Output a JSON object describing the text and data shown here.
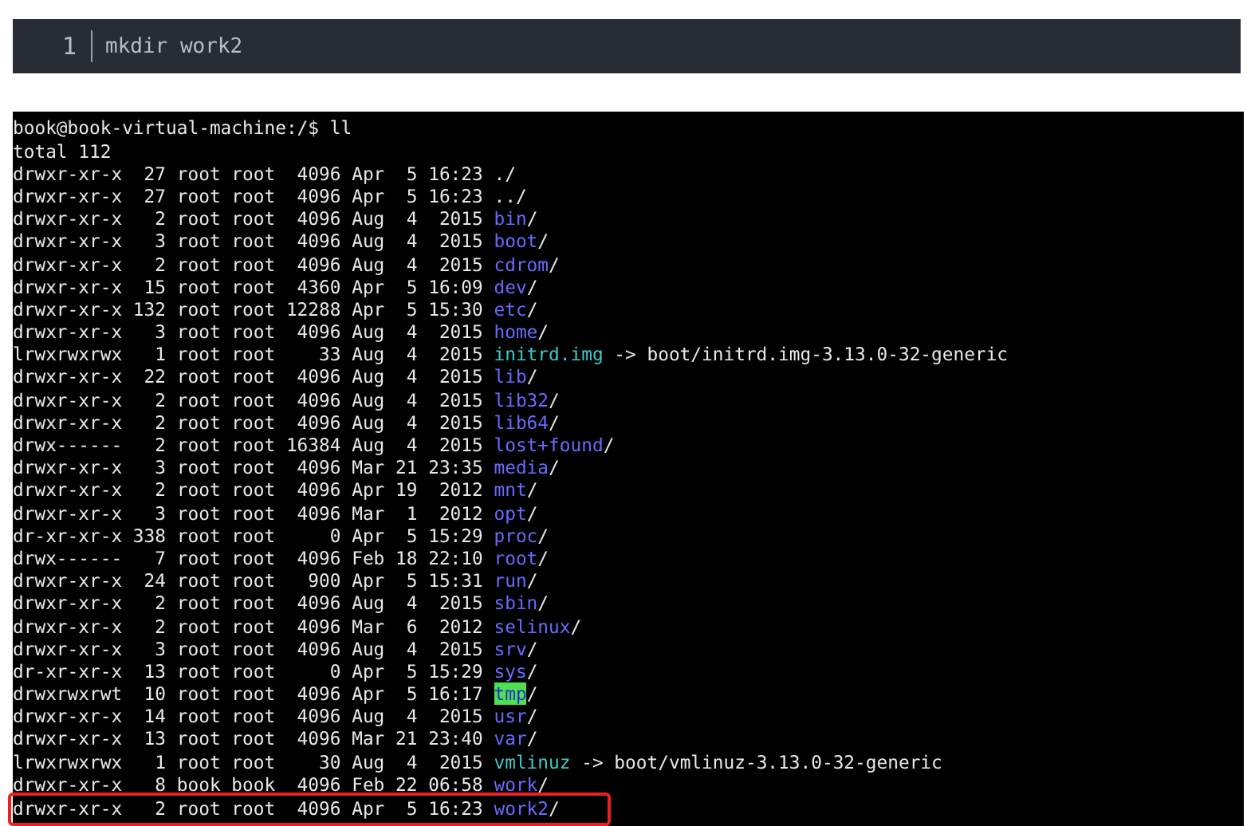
{
  "code_block": {
    "line_number": "1",
    "code": "mkdir work2"
  },
  "terminal": {
    "prompt": "book@book-virtual-machine:/$ ll",
    "total": "total 112",
    "entries": [
      {
        "info": "drwxr-xr-x  27 root root  4096 Apr  5 16:23",
        "name": ".",
        "suffix": "/",
        "kind": "plain",
        "highlighted": false
      },
      {
        "info": "drwxr-xr-x  27 root root  4096 Apr  5 16:23",
        "name": "..",
        "suffix": "/",
        "kind": "plain",
        "highlighted": false
      },
      {
        "info": "drwxr-xr-x   2 root root  4096 Aug  4  2015",
        "name": "bin",
        "suffix": "/",
        "kind": "dir",
        "highlighted": false
      },
      {
        "info": "drwxr-xr-x   3 root root  4096 Aug  4  2015",
        "name": "boot",
        "suffix": "/",
        "kind": "dir",
        "highlighted": false
      },
      {
        "info": "drwxr-xr-x   2 root root  4096 Aug  4  2015",
        "name": "cdrom",
        "suffix": "/",
        "kind": "dir",
        "highlighted": false
      },
      {
        "info": "drwxr-xr-x  15 root root  4360 Apr  5 16:09",
        "name": "dev",
        "suffix": "/",
        "kind": "dir",
        "highlighted": false
      },
      {
        "info": "drwxr-xr-x 132 root root 12288 Apr  5 15:30",
        "name": "etc",
        "suffix": "/",
        "kind": "dir",
        "highlighted": false
      },
      {
        "info": "drwxr-xr-x   3 root root  4096 Aug  4  2015",
        "name": "home",
        "suffix": "/",
        "kind": "dir",
        "highlighted": false
      },
      {
        "info": "lrwxrwxrwx   1 root root    33 Aug  4  2015",
        "name": "initrd.img",
        "suffix": "-> boot/initrd.img-3.13.0-32-generic",
        "kind": "link",
        "highlighted": false
      },
      {
        "info": "drwxr-xr-x  22 root root  4096 Aug  4  2015",
        "name": "lib",
        "suffix": "/",
        "kind": "dir",
        "highlighted": false
      },
      {
        "info": "drwxr-xr-x   2 root root  4096 Aug  4  2015",
        "name": "lib32",
        "suffix": "/",
        "kind": "dir",
        "highlighted": false
      },
      {
        "info": "drwxr-xr-x   2 root root  4096 Aug  4  2015",
        "name": "lib64",
        "suffix": "/",
        "kind": "dir",
        "highlighted": false
      },
      {
        "info": "drwx------   2 root root 16384 Aug  4  2015",
        "name": "lost+found",
        "suffix": "/",
        "kind": "dir",
        "highlighted": false
      },
      {
        "info": "drwxr-xr-x   3 root root  4096 Mar 21 23:35",
        "name": "media",
        "suffix": "/",
        "kind": "dir",
        "highlighted": false
      },
      {
        "info": "drwxr-xr-x   2 root root  4096 Apr 19  2012",
        "name": "mnt",
        "suffix": "/",
        "kind": "dir",
        "highlighted": false
      },
      {
        "info": "drwxr-xr-x   3 root root  4096 Mar  1  2012",
        "name": "opt",
        "suffix": "/",
        "kind": "dir",
        "highlighted": false
      },
      {
        "info": "dr-xr-xr-x 338 root root     0 Apr  5 15:29",
        "name": "proc",
        "suffix": "/",
        "kind": "dir",
        "highlighted": false
      },
      {
        "info": "drwx------   7 root root  4096 Feb 18 22:10",
        "name": "root",
        "suffix": "/",
        "kind": "dir",
        "highlighted": false
      },
      {
        "info": "drwxr-xr-x  24 root root   900 Apr  5 15:31",
        "name": "run",
        "suffix": "/",
        "kind": "dir",
        "highlighted": false
      },
      {
        "info": "drwxr-xr-x   2 root root  4096 Aug  4  2015",
        "name": "sbin",
        "suffix": "/",
        "kind": "dir",
        "highlighted": false
      },
      {
        "info": "drwxr-xr-x   2 root root  4096 Mar  6  2012",
        "name": "selinux",
        "suffix": "/",
        "kind": "dir",
        "highlighted": false
      },
      {
        "info": "drwxr-xr-x   3 root root  4096 Aug  4  2015",
        "name": "srv",
        "suffix": "/",
        "kind": "dir",
        "highlighted": false
      },
      {
        "info": "dr-xr-xr-x  13 root root     0 Apr  5 15:29",
        "name": "sys",
        "suffix": "/",
        "kind": "dir",
        "highlighted": false
      },
      {
        "info": "drwxrwxrwt  10 root root  4096 Apr  5 16:17",
        "name": "tmp",
        "suffix": "/",
        "kind": "sticky",
        "highlighted": false
      },
      {
        "info": "drwxr-xr-x  14 root root  4096 Aug  4  2015",
        "name": "usr",
        "suffix": "/",
        "kind": "dir",
        "highlighted": false
      },
      {
        "info": "drwxr-xr-x  13 root root  4096 Mar 21 23:40",
        "name": "var",
        "suffix": "/",
        "kind": "dir",
        "highlighted": false
      },
      {
        "info": "lrwxrwxrwx   1 root root    30 Aug  4  2015",
        "name": "vmlinuz",
        "suffix": "-> boot/vmlinuz-3.13.0-32-generic",
        "kind": "link",
        "highlighted": false
      },
      {
        "info": "drwxr-xr-x   8 book book  4096 Feb 22 06:58",
        "name": "work",
        "suffix": "/",
        "kind": "dir",
        "highlighted": false
      },
      {
        "info": "drwxr-xr-x   2 root root  4096 Apr  5 16:23",
        "name": "work2",
        "suffix": "/",
        "kind": "dir",
        "highlighted": true
      }
    ]
  }
}
